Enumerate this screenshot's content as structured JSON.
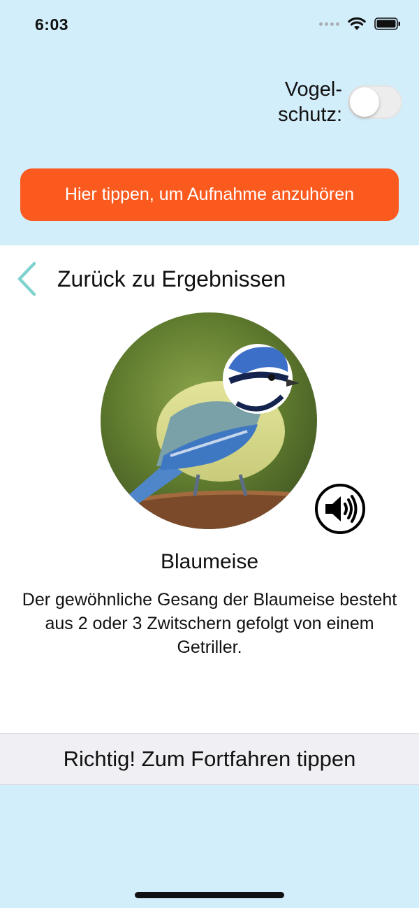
{
  "status_bar": {
    "time": "6:03"
  },
  "bird_protection": {
    "label_line1": "Vogel-",
    "label_line2": "schutz:",
    "enabled": false
  },
  "listen_button": {
    "label": "Hier tippen, um Aufnahme anzuhören"
  },
  "back": {
    "label": "Zurück zu Ergebnissen"
  },
  "bird": {
    "name": "Blaumeise",
    "description": "Der gewöhnliche Gesang der Blaumeise besteht aus 2 oder 3 Zwitschern gefolgt von einem Getriller."
  },
  "continue_bar": {
    "label": "Richtig! Zum Fortfahren tippen"
  },
  "colors": {
    "background": "#d3eefb",
    "accent": "#fb5a1f",
    "back_chevron": "#7fd3cf"
  }
}
